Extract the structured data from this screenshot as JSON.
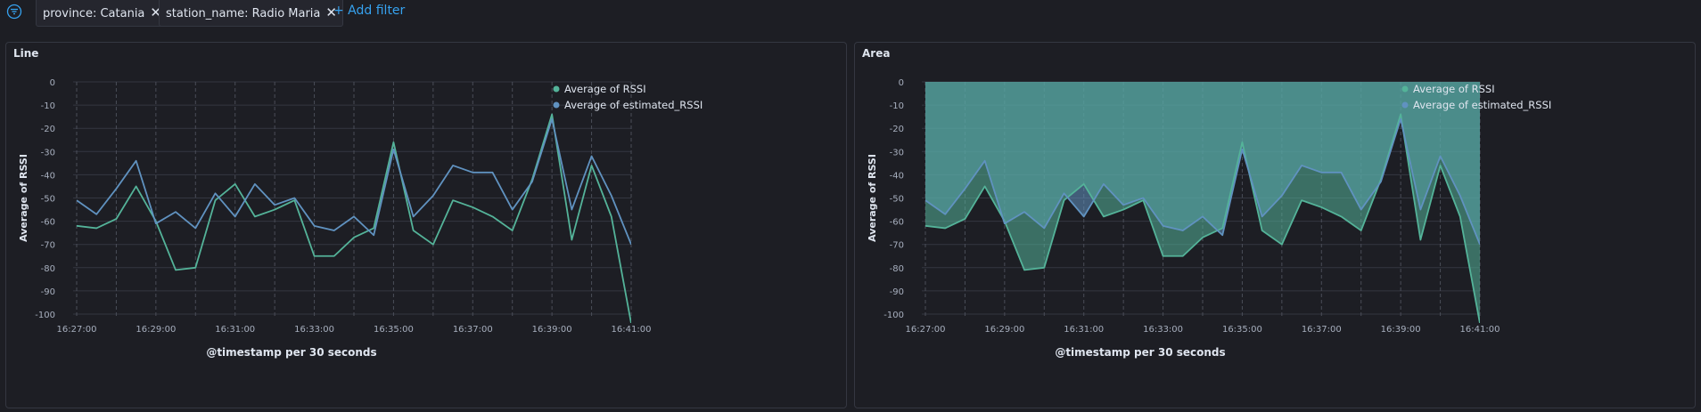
{
  "filters": [
    {
      "label": "province: Catania"
    },
    {
      "label": "station_name: Radio Maria"
    }
  ],
  "add_filter_label": "+ Add filter",
  "panels": [
    {
      "title": "Line"
    },
    {
      "title": "Area"
    }
  ],
  "chart_data": [
    {
      "type": "line",
      "title": "Line",
      "xlabel": "@timestamp per 30 seconds",
      "ylabel": "Average of RSSI",
      "ylim": [
        -100,
        0
      ],
      "yticks": [
        0,
        -10,
        -20,
        -30,
        -40,
        -50,
        -60,
        -70,
        -80,
        -90,
        -100
      ],
      "xtick_labels": [
        "16:27:00",
        "16:29:00",
        "16:31:00",
        "16:33:00",
        "16:35:00",
        "16:37:00",
        "16:39:00",
        "16:41:00"
      ],
      "x": [
        "16:27:00",
        "16:27:30",
        "16:28:00",
        "16:28:30",
        "16:29:00",
        "16:29:30",
        "16:30:00",
        "16:30:30",
        "16:31:00",
        "16:31:30",
        "16:32:00",
        "16:32:30",
        "16:33:00",
        "16:33:30",
        "16:34:00",
        "16:34:30",
        "16:35:00",
        "16:35:30",
        "16:36:00",
        "16:36:30",
        "16:37:00",
        "16:37:30",
        "16:38:00",
        "16:38:30",
        "16:39:00",
        "16:39:30",
        "16:40:00",
        "16:40:30",
        "16:41:00"
      ],
      "series": [
        {
          "name": "Average of RSSI",
          "color": "#54b399",
          "values": [
            -62,
            -63,
            -59,
            -45,
            -60,
            -81,
            -80,
            -51,
            -44,
            -58,
            -55,
            -51,
            -75,
            -75,
            -67,
            -63,
            -26,
            -64,
            -70,
            -51,
            -54,
            -58,
            -64,
            -42,
            -14,
            -68,
            -36,
            -58,
            -104
          ]
        },
        {
          "name": "Average of estimated_RSSI",
          "color": "#6092c0",
          "values": [
            -51,
            -57,
            -46,
            -34,
            -61,
            -56,
            -63,
            -48,
            -58,
            -44,
            -53,
            -50,
            -62,
            -64,
            -58,
            -66,
            -29,
            -58,
            -49,
            -36,
            -39,
            -39,
            -55,
            -43,
            -16,
            -55,
            -32,
            -49,
            -70
          ]
        }
      ],
      "legend": "top-right",
      "grid": true
    },
    {
      "type": "area",
      "title": "Area",
      "xlabel": "@timestamp per 30 seconds",
      "ylabel": "Average of RSSI",
      "ylim": [
        -100,
        0
      ],
      "yticks": [
        0,
        -10,
        -20,
        -30,
        -40,
        -50,
        -60,
        -70,
        -80,
        -90,
        -100
      ],
      "xtick_labels": [
        "16:27:00",
        "16:29:00",
        "16:31:00",
        "16:33:00",
        "16:35:00",
        "16:37:00",
        "16:39:00",
        "16:41:00"
      ],
      "x": [
        "16:27:00",
        "16:27:30",
        "16:28:00",
        "16:28:30",
        "16:29:00",
        "16:29:30",
        "16:30:00",
        "16:30:30",
        "16:31:00",
        "16:31:30",
        "16:32:00",
        "16:32:30",
        "16:33:00",
        "16:33:30",
        "16:34:00",
        "16:34:30",
        "16:35:00",
        "16:35:30",
        "16:36:00",
        "16:36:30",
        "16:37:00",
        "16:37:30",
        "16:38:00",
        "16:38:30",
        "16:39:00",
        "16:39:30",
        "16:40:00",
        "16:40:30",
        "16:41:00"
      ],
      "series": [
        {
          "name": "Average of RSSI",
          "color": "#54b399",
          "values": [
            -62,
            -63,
            -59,
            -45,
            -60,
            -81,
            -80,
            -51,
            -44,
            -58,
            -55,
            -51,
            -75,
            -75,
            -67,
            -63,
            -26,
            -64,
            -70,
            -51,
            -54,
            -58,
            -64,
            -42,
            -14,
            -68,
            -36,
            -58,
            -104
          ]
        },
        {
          "name": "Average of estimated_RSSI",
          "color": "#6092c0",
          "values": [
            -51,
            -57,
            -46,
            -34,
            -61,
            -56,
            -63,
            -48,
            -58,
            -44,
            -53,
            -50,
            -62,
            -64,
            -58,
            -66,
            -29,
            -58,
            -49,
            -36,
            -39,
            -39,
            -55,
            -43,
            -16,
            -55,
            -32,
            -49,
            -70
          ]
        }
      ],
      "legend": "top-right",
      "grid": true
    }
  ]
}
